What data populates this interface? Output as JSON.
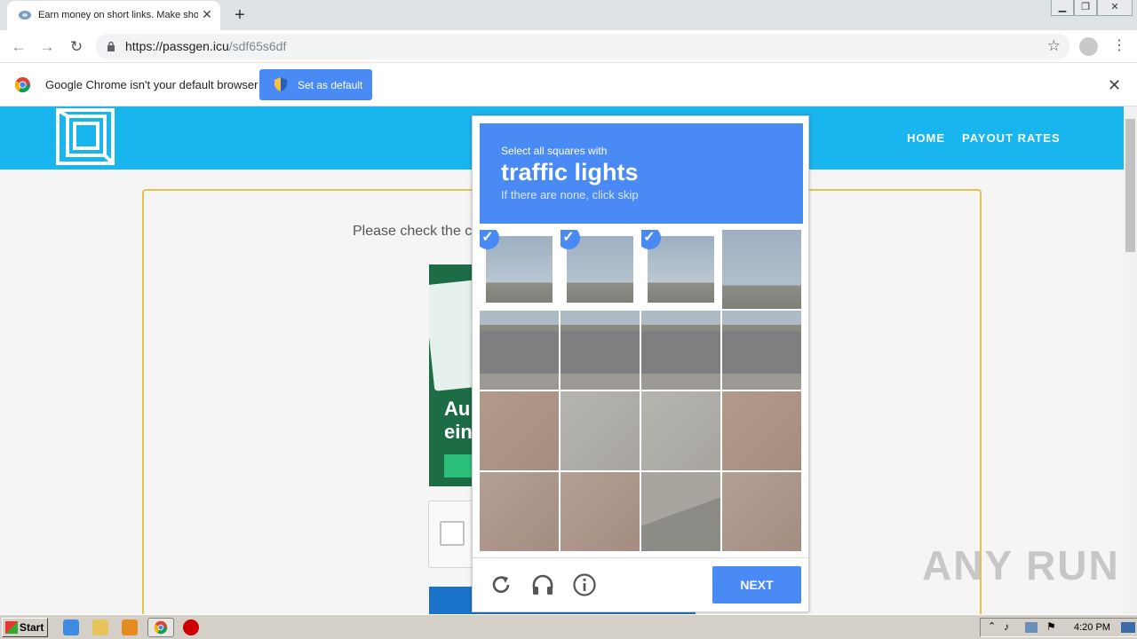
{
  "browser": {
    "tab_title": "Earn money on short links. Make sho",
    "url_host": "https://passgen.icu",
    "url_path": "/sdf65s6df",
    "new_tab": "+",
    "tab_close": "✕"
  },
  "infobar": {
    "message": "Google Chrome isn't your default browser",
    "button": "Set as default",
    "close": "✕"
  },
  "site": {
    "nav": [
      "HOME",
      "PAYOUT RATES"
    ],
    "prompt": "Please check the c",
    "ad_text": "Au\nein"
  },
  "captcha": {
    "instruction_small": "Select all squares with",
    "target": "traffic lights",
    "hint": "If there are none, click skip",
    "next_label": "NEXT",
    "selected_cells": [
      0,
      1,
      2
    ]
  },
  "watermark": "ANY RUN",
  "taskbar": {
    "start": "Start",
    "clock": "4:20 PM"
  },
  "colors": {
    "captcha_blue": "#4a8af4",
    "site_header": "#18b5ee"
  }
}
